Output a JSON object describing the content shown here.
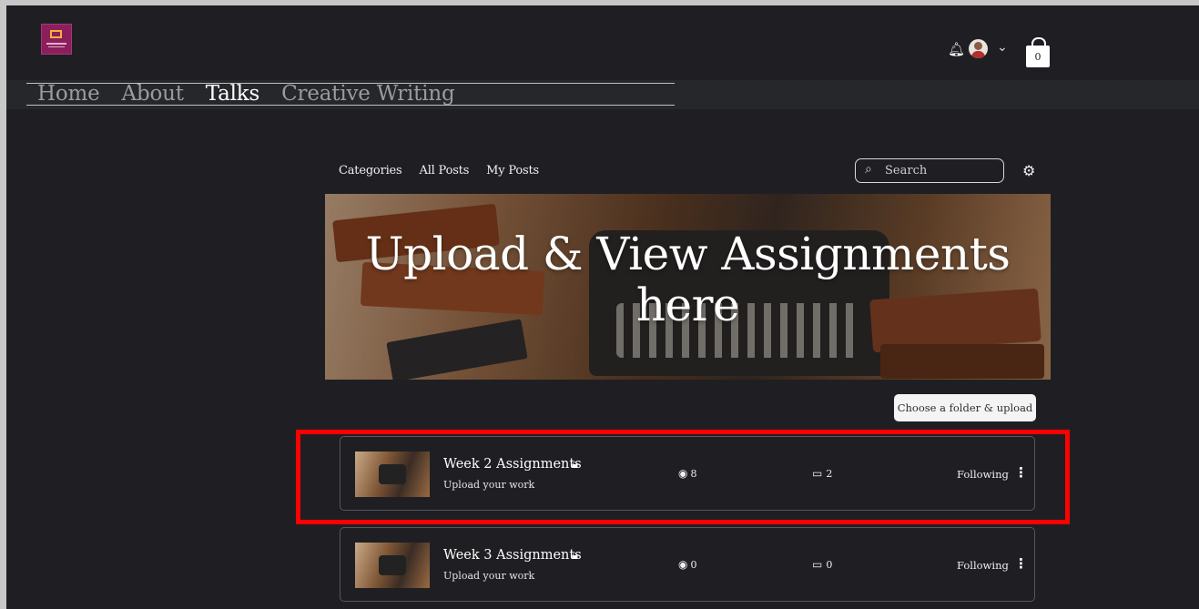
{
  "header": {
    "logo_icon": "site-logo",
    "notifications_icon": "bell-icon",
    "profile_icon": "avatar",
    "dropdown_icon": "chevron-down-icon",
    "cart_count": "0"
  },
  "nav": {
    "items": [
      {
        "label": "Home",
        "active": false
      },
      {
        "label": "About",
        "active": false
      },
      {
        "label": "Talks",
        "active": true
      },
      {
        "label": "Creative Writing",
        "active": false
      }
    ]
  },
  "forum": {
    "tabs": [
      {
        "label": "Categories"
      },
      {
        "label": "All Posts"
      },
      {
        "label": "My Posts"
      }
    ],
    "search": {
      "placeholder": "Search",
      "icon": "search-icon"
    },
    "settings_icon": "gear-icon",
    "hero_title": "Upload & View Assignments here",
    "upload_button": "Choose a folder & upload",
    "categories": [
      {
        "name": "Week 2 Assignments",
        "subtitle": "Upload your work",
        "views": "8",
        "comments": "2",
        "follow": "Following",
        "locked": true
      },
      {
        "name": "Week 3 Assignments",
        "subtitle": "Upload your work",
        "views": "0",
        "comments": "0",
        "follow": "Following",
        "locked": true
      }
    ]
  },
  "colors": {
    "background": "#1f1f23",
    "highlight": "#ff0000",
    "logo": "#8b1f5c"
  }
}
